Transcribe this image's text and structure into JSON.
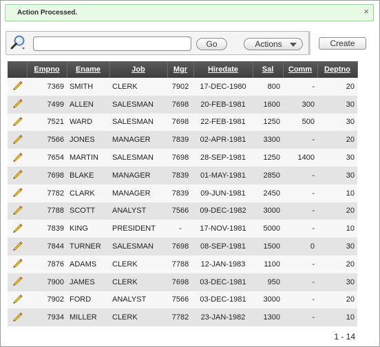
{
  "message": {
    "text": "Action Processed.",
    "close_glyph": "×"
  },
  "toolbar": {
    "search_placeholder": "",
    "go_label": "Go",
    "actions_label": "Actions",
    "create_label": "Create"
  },
  "columns": [
    "Empno",
    "Ename",
    "Job",
    "Mgr",
    "Hiredate",
    "Sal",
    "Comm",
    "Deptno"
  ],
  "rows": [
    [
      "7369",
      "SMITH",
      "CLERK",
      "7902",
      "17-DEC-1980",
      "800",
      "-",
      "20"
    ],
    [
      "7499",
      "ALLEN",
      "SALESMAN",
      "7698",
      "20-FEB-1981",
      "1600",
      "300",
      "30"
    ],
    [
      "7521",
      "WARD",
      "SALESMAN",
      "7698",
      "22-FEB-1981",
      "1250",
      "500",
      "30"
    ],
    [
      "7566",
      "JONES",
      "MANAGER",
      "7839",
      "02-APR-1981",
      "3300",
      "-",
      "20"
    ],
    [
      "7654",
      "MARTIN",
      "SALESMAN",
      "7698",
      "28-SEP-1981",
      "1250",
      "1400",
      "30"
    ],
    [
      "7698",
      "BLAKE",
      "MANAGER",
      "7839",
      "01-MAY-1981",
      "2850",
      "-",
      "30"
    ],
    [
      "7782",
      "CLARK",
      "MANAGER",
      "7839",
      "09-JUN-1981",
      "2450",
      "-",
      "10"
    ],
    [
      "7788",
      "SCOTT",
      "ANALYST",
      "7566",
      "09-DEC-1982",
      "3000",
      "-",
      "20"
    ],
    [
      "7839",
      "KING",
      "PRESIDENT",
      "-",
      "17-NOV-1981",
      "5000",
      "-",
      "10"
    ],
    [
      "7844",
      "TURNER",
      "SALESMAN",
      "7698",
      "08-SEP-1981",
      "1500",
      "0",
      "30"
    ],
    [
      "7876",
      "ADAMS",
      "CLERK",
      "7788",
      "12-JAN-1983",
      "1100",
      "-",
      "20"
    ],
    [
      "7900",
      "JAMES",
      "CLERK",
      "7698",
      "03-DEC-1981",
      "950",
      "-",
      "30"
    ],
    [
      "7902",
      "FORD",
      "ANALYST",
      "7566",
      "03-DEC-1981",
      "3000",
      "-",
      "20"
    ],
    [
      "7934",
      "MILLER",
      "CLERK",
      "7782",
      "23-JAN-1982",
      "1300",
      "-",
      "10"
    ]
  ],
  "pagination": {
    "text": "1 - 14"
  },
  "icons": {
    "search": "magnifier-icon",
    "edit": "pencil-icon",
    "actions": "chevron-down-icon",
    "close": "close-icon"
  },
  "colors": {
    "message_bg": "#e6fae6",
    "header_bg": "#4a4a4a",
    "row_odd": "#f7f7f7",
    "row_even": "#e4e4e4"
  }
}
